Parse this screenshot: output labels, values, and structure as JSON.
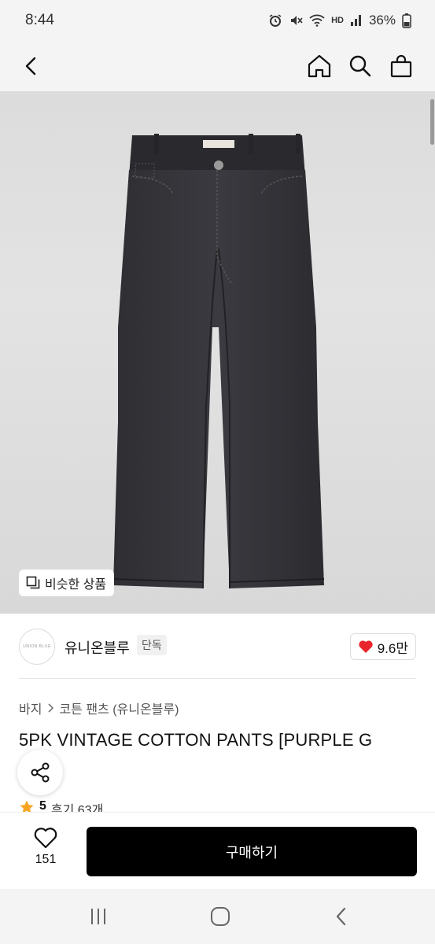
{
  "status_bar": {
    "time": "8:44",
    "battery": "36%",
    "network_label": "HD"
  },
  "nav": {
    "back_icon": "chevron-left-icon",
    "home_icon": "home-icon",
    "search_icon": "search-icon",
    "cart_icon": "shopping-bag-icon"
  },
  "product_image": {
    "similar_label": "비슷한 상품",
    "similar_icon": "copy-icon"
  },
  "brand": {
    "name": "유니온블루",
    "tag": "단독",
    "logo_text": "UNION BLUE",
    "likes": "9.6만",
    "like_color": "#e8262c"
  },
  "breadcrumb": {
    "level1": "바지",
    "level2": "코튼 팬츠 (유니온블루)"
  },
  "product": {
    "title": "5PK VINTAGE COTTON PANTS [PURPLE G",
    "rating": "5",
    "review_text": "후기 63개"
  },
  "bottom_bar": {
    "wish_count": "151",
    "buy_label": "구매하기"
  },
  "system_nav": {
    "recents_icon": "recents-icon",
    "home_icon": "home-circle-icon",
    "back_icon": "back-icon"
  }
}
